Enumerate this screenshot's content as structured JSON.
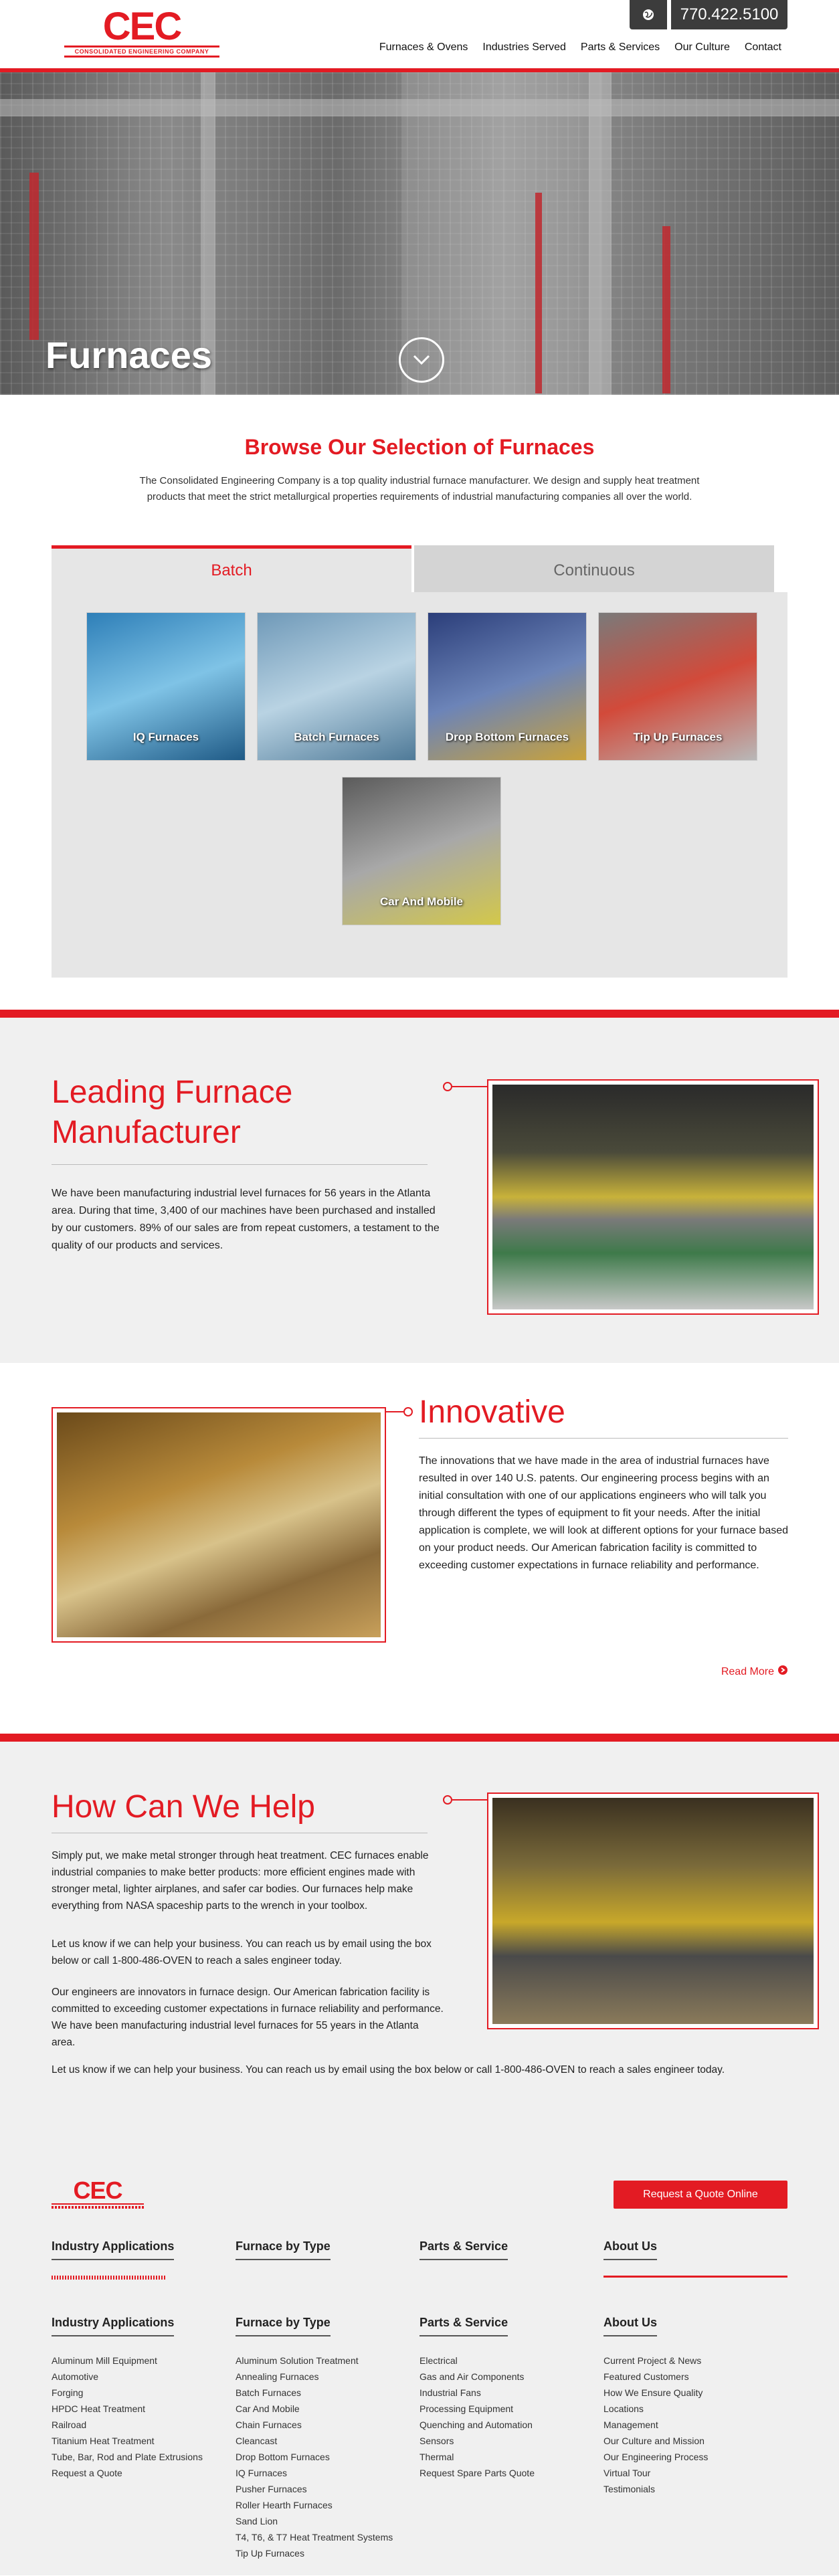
{
  "header": {
    "logo_text": "CEC",
    "logo_subtitle": "CONSOLIDATED ENGINEERING COMPANY",
    "phone": "770.422.5100",
    "globe_icon": "globe-icon",
    "nav": [
      "Furnaces & Ovens",
      "Industries Served",
      "Parts & Services",
      "Our Culture",
      "Contact"
    ]
  },
  "hero": {
    "title": "Furnaces",
    "scroll_icon": "chevron-down-circle-icon"
  },
  "browse": {
    "title": "Browse Our Selection of Furnaces",
    "intro": "The Consolidated Engineering Company is a top quality industrial furnace manufacturer. We design and supply heat treatment products that meet the strict metallurgical properties requirements of industrial manufacturing companies all over the world.",
    "tabs": [
      {
        "label": "Batch",
        "active": true
      },
      {
        "label": "Continuous",
        "active": false
      }
    ],
    "tiles": [
      {
        "label": "IQ Furnaces",
        "colors": [
          "#2e7fb8",
          "#7fc3e6",
          "#1f5a86"
        ]
      },
      {
        "label": "Batch Furnaces",
        "colors": [
          "#6f99b8",
          "#b9d3e3",
          "#4f7a98"
        ]
      },
      {
        "label": "Drop Bottom Furnaces",
        "colors": [
          "#2b3e7a",
          "#6c84b8",
          "#c9a23a"
        ]
      },
      {
        "label": "Tip Up Furnaces",
        "colors": [
          "#7a7a7a",
          "#d24a3a",
          "#b8b8b8"
        ]
      },
      {
        "label": "Car And Mobile",
        "colors": [
          "#5b5b5b",
          "#a8a8a8",
          "#d3c84a"
        ]
      }
    ]
  },
  "leading": {
    "title": "Leading Furnace Manufacturer",
    "text": " We have been manufacturing industrial level furnaces for 56 years in the Atlanta area. During that time, 3,400 of our machines have been purchased and installed by our customers. 89% of our sales are from repeat customers, a testament to the quality of our products and services."
  },
  "innovative": {
    "title": "Innovative",
    "text": "The innovations that we have made in the area of industrial furnaces have resulted in over 140 U.S. patents. Our engineering process begins with an initial consultation with one of our applications engineers who will talk you through different the types of equipment to fit your needs. After the initial application is complete, we will look at different options for your furnace based on your product needs. Our American fabrication facility is committed to exceeding customer expectations in furnace reliability and performance.",
    "read_more": "Read More"
  },
  "help": {
    "title": "How Can We Help",
    "paragraphs": [
      "Simply put, we make metal stronger through heat treatment. CEC furnaces enable industrial companies to make better products: more efficient engines made with stronger metal, lighter airplanes, and safer car bodies. Our furnaces help make everything from NASA spaceship parts to the wrench in your toolbox.",
      "Let us know if we can help your business. You can reach us by email using the box below or call 1-800-486-OVEN to reach a sales engineer today.",
      "Our engineers are innovators in furnace design. Our American fabrication facility is committed to exceeding customer expectations in furnace reliability and performance. We have been manufacturing industrial level furnaces for 55 years in the Atlanta area."
    ],
    "closing": "Let us know if we can help your business. You can reach us by email using the box below or call 1-800-486-OVEN to reach a sales engineer today."
  },
  "footer": {
    "logo_text": "CEC",
    "quote_button": "Request a Quote Online",
    "top_headings": [
      "Industry Applications",
      "Furnace by Type",
      "Parts & Service",
      "About Us"
    ],
    "columns": [
      {
        "heading": "Industry Applications",
        "items": [
          "Aluminum Mill Equipment",
          "Automotive",
          "Forging",
          "HPDC Heat Treatment",
          "Railroad",
          "Titanium Heat Treatment",
          "Tube, Bar, Rod and Plate Extrusions",
          "Request a Quote"
        ]
      },
      {
        "heading": "Furnace by Type",
        "items": [
          "Aluminum Solution Treatment",
          "Annealing Furnaces",
          "Batch Furnaces",
          "Car And Mobile",
          "Chain Furnaces",
          "Cleancast",
          "Drop Bottom Furnaces",
          "IQ Furnaces",
          "Pusher Furnaces",
          "Roller Hearth Furnaces",
          "Sand Lion",
          "T4, T6, & T7 Heat Treatment Systems",
          "Tip Up Furnaces"
        ]
      },
      {
        "heading": "Parts & Service",
        "items": [
          "Electrical",
          "Gas and Air Components",
          "Industrial Fans",
          "Processing Equipment",
          "Quenching and Automation",
          "Sensors",
          "Thermal",
          "Request Spare Parts Quote"
        ]
      },
      {
        "heading": "About Us",
        "items": [
          "Current Project & News",
          "Featured Customers",
          "How We Ensure Quality",
          "Locations",
          "Management",
          "Our Culture and Mission",
          "Our Engineering Process",
          "Virtual Tour",
          "Testimonials"
        ]
      }
    ]
  }
}
